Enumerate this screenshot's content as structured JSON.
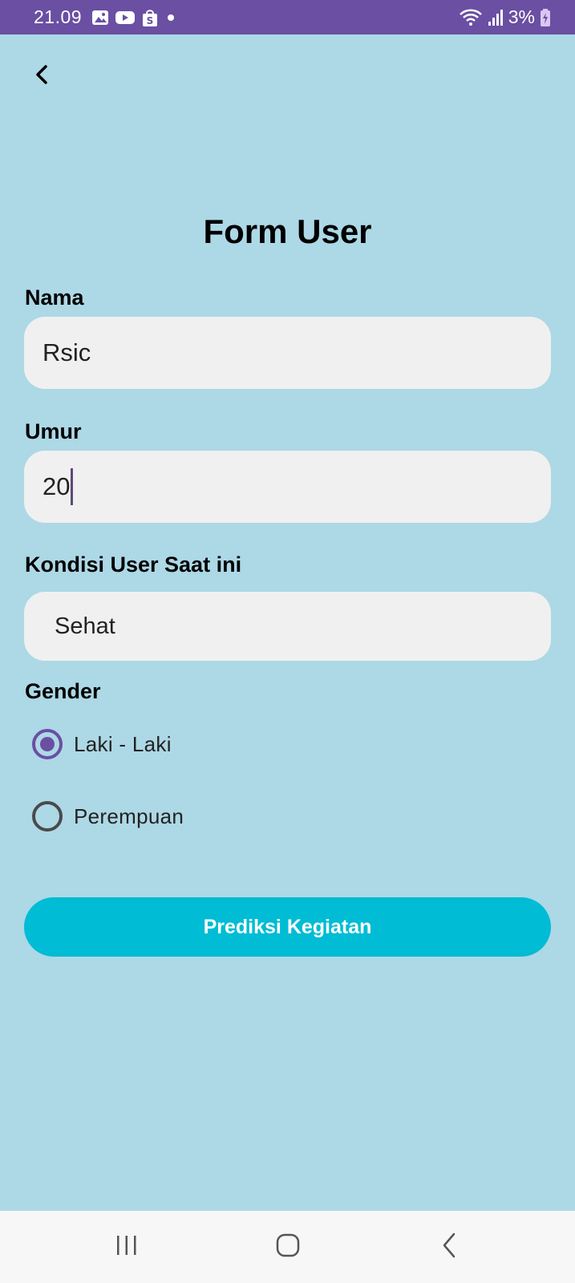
{
  "status_bar": {
    "time": "21.09",
    "battery_text": "3%",
    "left_icons": [
      "image-icon",
      "youtube-icon",
      "shopee-bag-icon",
      "dot-icon"
    ],
    "right_icons": [
      "wifi-icon",
      "signal-icon",
      "battery-charging-icon"
    ]
  },
  "form": {
    "title": "Form User",
    "nama": {
      "label": "Nama",
      "value": "Rsic"
    },
    "umur": {
      "label": "Umur",
      "value": "20"
    },
    "kondisi": {
      "label": "Kondisi User Saat ini",
      "value": "Sehat"
    },
    "gender": {
      "label": "Gender",
      "options": [
        {
          "label": "Laki - Laki",
          "selected": true
        },
        {
          "label": "Perempuan",
          "selected": false
        }
      ]
    },
    "submit_label": "Prediksi Kegiatan"
  },
  "colors": {
    "status_bar": "#6a4fa3",
    "background": "#add8e6",
    "field_background": "#f0f0f0",
    "button": "#00bcd4",
    "radio_accent": "#6a4fa3"
  },
  "nav_bar": {
    "buttons": [
      "recent-apps-icon",
      "home-icon",
      "back-icon"
    ]
  }
}
